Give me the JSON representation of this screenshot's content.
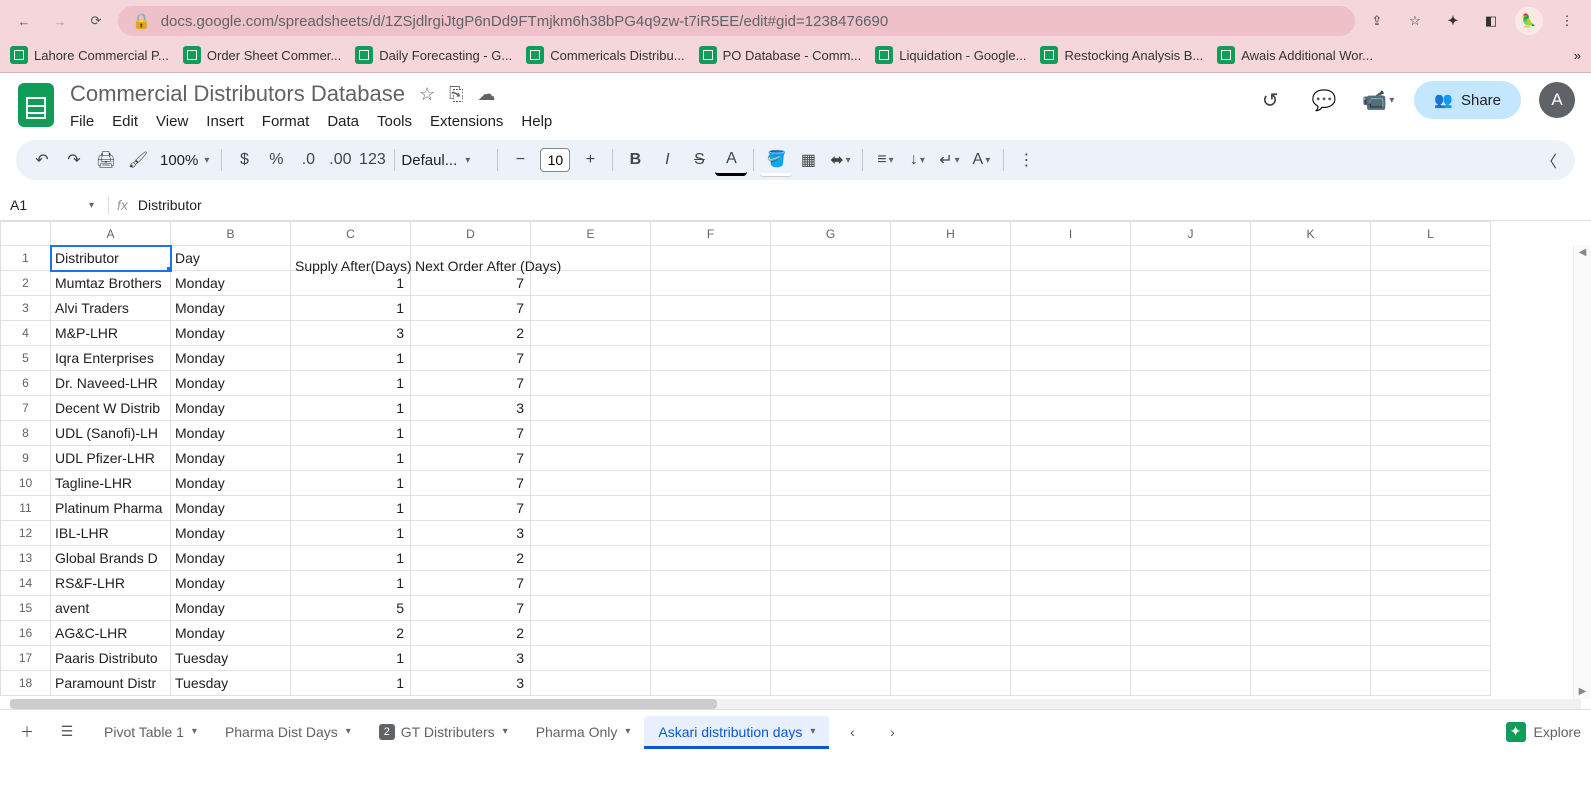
{
  "browser": {
    "url": "docs.google.com/spreadsheets/d/1ZSjdlrgiJtgP6nDd9FTmjkm6h38bPG4q9zw-t7iR5EE/edit#gid=1238476690",
    "bookmarks": [
      "Lahore Commercial P...",
      "Order Sheet Commer...",
      "Daily Forecasting - G...",
      "Commericals Distribu...",
      "PO Database - Comm...",
      "Liquidation - Google...",
      "Restocking Analysis B...",
      "Awais Additional Wor..."
    ]
  },
  "doc": {
    "title": "Commercial Distributors Database",
    "menus": [
      "File",
      "Edit",
      "View",
      "Insert",
      "Format",
      "Data",
      "Tools",
      "Extensions",
      "Help"
    ],
    "share": "Share",
    "avatar": "A"
  },
  "toolbar": {
    "zoom": "100%",
    "font": "Defaul...",
    "fontsize": "10"
  },
  "namebox": "A1",
  "formula": "Distributor",
  "columns": [
    "A",
    "B",
    "C",
    "D",
    "E",
    "F",
    "G",
    "H",
    "I",
    "J",
    "K",
    "L"
  ],
  "rows": [
    {
      "n": 1,
      "a": "Distributor",
      "b": "Day",
      "c": "Supply After(Days)",
      "d": "Next Order After (Days)",
      "cIsHeader": true
    },
    {
      "n": 2,
      "a": "Mumtaz Brothers",
      "b": "Monday",
      "c": "1",
      "d": "7"
    },
    {
      "n": 3,
      "a": "Alvi Traders",
      "b": "Monday",
      "c": "1",
      "d": "7"
    },
    {
      "n": 4,
      "a": "M&P-LHR",
      "b": "Monday",
      "c": "3",
      "d": "2"
    },
    {
      "n": 5,
      "a": "Iqra Enterprises",
      "b": "Monday",
      "c": "1",
      "d": "7"
    },
    {
      "n": 6,
      "a": "Dr. Naveed-LHR",
      "b": "Monday",
      "c": "1",
      "d": "7"
    },
    {
      "n": 7,
      "a": "Decent W Distrib",
      "b": "Monday",
      "c": "1",
      "d": "3"
    },
    {
      "n": 8,
      "a": "UDL (Sanofi)-LH",
      "b": "Monday",
      "c": "1",
      "d": "7"
    },
    {
      "n": 9,
      "a": "UDL Pfizer-LHR",
      "b": "Monday",
      "c": "1",
      "d": "7"
    },
    {
      "n": 10,
      "a": "Tagline-LHR",
      "b": "Monday",
      "c": "1",
      "d": "7"
    },
    {
      "n": 11,
      "a": "Platinum Pharma",
      "b": "Monday",
      "c": "1",
      "d": "7"
    },
    {
      "n": 12,
      "a": "IBL-LHR",
      "b": "Monday",
      "c": "1",
      "d": "3"
    },
    {
      "n": 13,
      "a": "Global Brands D",
      "b": "Monday",
      "c": "1",
      "d": "2"
    },
    {
      "n": 14,
      "a": "RS&F-LHR",
      "b": "Monday",
      "c": "1",
      "d": "7"
    },
    {
      "n": 15,
      "a": "avent",
      "b": "Monday",
      "c": "5",
      "d": "7"
    },
    {
      "n": 16,
      "a": "AG&C-LHR",
      "b": "Monday",
      "c": "2",
      "d": "2"
    },
    {
      "n": 17,
      "a": "Paaris Distributo",
      "b": "Tuesday",
      "c": "1",
      "d": "3"
    },
    {
      "n": 18,
      "a": "Paramount Distr",
      "b": "Tuesday",
      "c": "1",
      "d": "3"
    }
  ],
  "sheets": {
    "tabs": [
      {
        "label": "Pivot Table 1"
      },
      {
        "label": "Pharma Dist Days"
      },
      {
        "label": "GT Distributers",
        "badge": "2"
      },
      {
        "label": "Pharma Only"
      },
      {
        "label": "Askari distribution days",
        "active": true
      }
    ],
    "explore": "Explore"
  }
}
